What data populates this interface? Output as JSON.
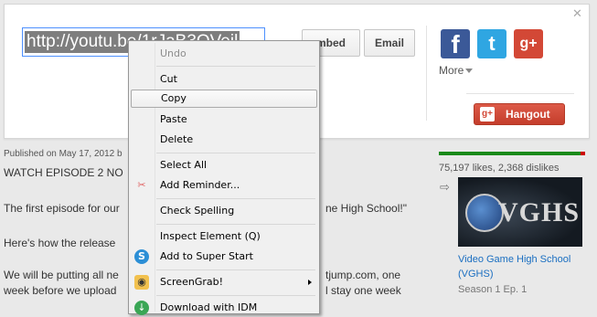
{
  "share": {
    "url": "http://youtu.be/1rJaB3OVeil",
    "embed_label": "mbed",
    "email_label": "Email",
    "close_glyph": "✕",
    "more_label": "More",
    "hangout_label": "Hangout",
    "icons": {
      "facebook": "facebook-icon",
      "twitter": "twitter-icon",
      "google_plus": "google-plus-icon"
    }
  },
  "description": {
    "published": "Published on May 17, 2012 b",
    "watch": "WATCH EPISODE 2 NO",
    "first_start": "The first episode for our",
    "first_end": "ne High School!\"",
    "release": "Here's how the release",
    "putting_start": "We will be putting all ne",
    "putting_end": "tjump.com, one",
    "week_start": "week before we upload",
    "week_end": "l stay one week"
  },
  "sidebar": {
    "likes_text": "75,197 likes, 2,368 dislikes",
    "like_ratio": 0.97,
    "thumb_text": "VGHS",
    "video_title": "Video Game High School (VGHS)",
    "video_sub": "Season 1 Ep. 1"
  },
  "context_menu": {
    "items": [
      {
        "label": "Undo",
        "accel": "U",
        "disabled": true
      },
      {
        "label": "Cut",
        "accel": "t"
      },
      {
        "label": "Copy",
        "accel": "C",
        "hover": true
      },
      {
        "label": "Paste",
        "accel": "P"
      },
      {
        "label": "Delete",
        "accel": "D"
      },
      {
        "label": "Select All",
        "accel": "A"
      },
      {
        "label": "Add Reminder..."
      },
      {
        "label": "Check Spelling",
        "accel": "S"
      },
      {
        "label": "Inspect Element (Q)",
        "accel": "Q"
      },
      {
        "label": "Add to Super Start"
      },
      {
        "label": "ScreenGrab!",
        "submenu": true
      },
      {
        "label": "Download with IDM"
      }
    ]
  },
  "colors": {
    "accent_blue": "#4d90fe",
    "like_green": "#1a8a1a",
    "dislike_red": "#cc0000",
    "hangout_red": "#d34836"
  }
}
